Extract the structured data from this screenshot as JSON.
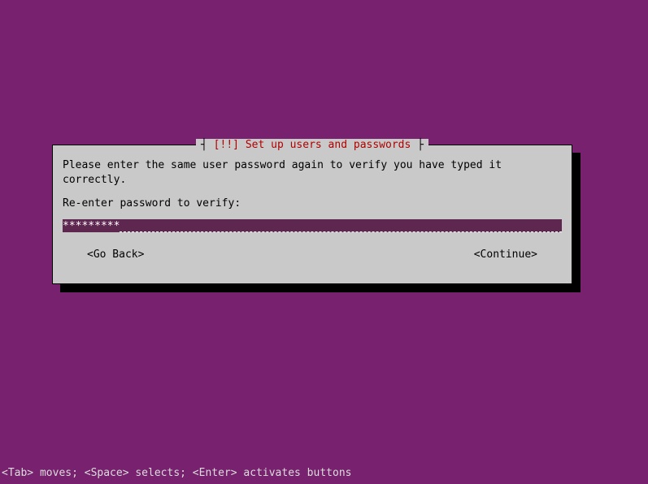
{
  "dialog": {
    "title_marker": "[!!]",
    "title_text": "Set up users and passwords",
    "instruction": "Please enter the same user password again to verify you have typed it correctly.",
    "prompt_label": "Re-enter password to verify:",
    "input_value_masked": "*********",
    "go_back_label": "<Go Back>",
    "continue_label": "<Continue>"
  },
  "footer": {
    "hint": "<Tab> moves; <Space> selects; <Enter> activates buttons"
  }
}
